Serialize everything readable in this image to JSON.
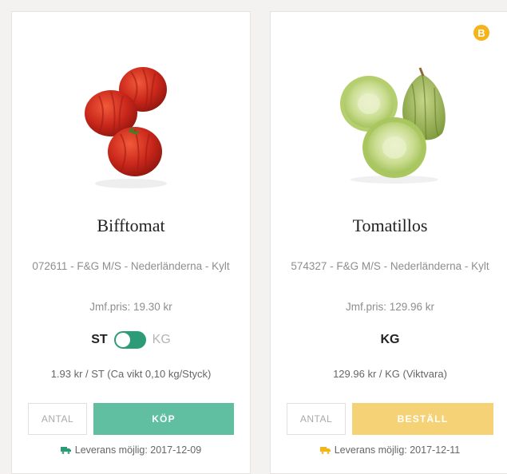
{
  "products": [
    {
      "name": "Bifftomat",
      "meta": "072611 - F&G M/S - Nederländerna - Kylt",
      "jmf": "Jmf.pris: 19.30 kr",
      "unit_active": "ST",
      "unit_inactive": "KG",
      "has_toggle": true,
      "price": "1.93 kr / ST (Ca vikt 0,10 kg/Styck)",
      "qty_placeholder": "ANTAL",
      "button_label": "KÖP",
      "delivery": "Leverans möjlig: 2017-12-09",
      "delivery_icon_color": "#2d9b78",
      "badge": null
    },
    {
      "name": "Tomatillos",
      "meta": "574327 - F&G M/S - Nederländerna - Kylt",
      "jmf": "Jmf.pris: 129.96 kr",
      "unit_active": "KG",
      "has_toggle": false,
      "price": "129.96 kr / KG (Viktvara)",
      "qty_placeholder": "ANTAL",
      "button_label": "BESTÄLL",
      "delivery": "Leverans möjlig: 2017-12-11",
      "delivery_icon_color": "#f4b41a",
      "badge": "B"
    }
  ],
  "colors": {
    "buy_button": "#5fbfa0",
    "order_button": "#f6d277",
    "toggle": "#2d9b78",
    "badge": "#f4b41a"
  }
}
